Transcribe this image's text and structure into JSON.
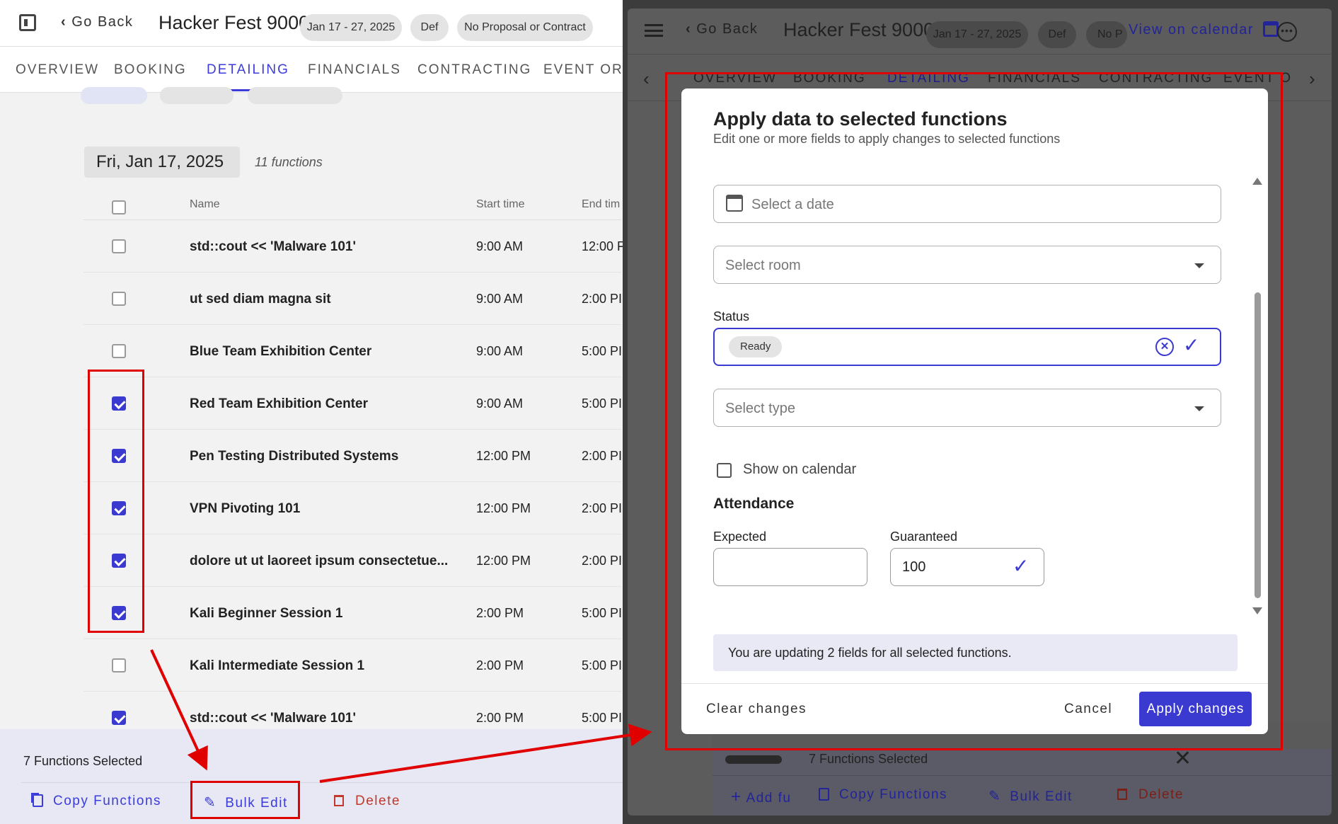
{
  "left": {
    "header": {
      "back": "Go Back",
      "title": "Hacker Fest 9000",
      "dates": "Jan 17 - 27, 2025",
      "status": "Def",
      "contract": "No Proposal or Contract"
    },
    "tabs": [
      "OVERVIEW",
      "BOOKING",
      "DETAILING",
      "FINANCIALS",
      "CONTRACTING",
      "EVENT ORDE"
    ],
    "date_heading": "Fri, Jan 17, 2025",
    "function_count": "11 functions",
    "columns": {
      "name": "Name",
      "start": "Start time",
      "end": "End tim"
    },
    "rows": [
      {
        "name": "std::cout << 'Malware 101'",
        "start": "9:00 AM",
        "end": "12:00 F",
        "checked": false
      },
      {
        "name": "ut sed diam magna sit",
        "start": "9:00 AM",
        "end": "2:00 PI",
        "checked": false
      },
      {
        "name": "Blue Team Exhibition Center",
        "start": "9:00 AM",
        "end": "5:00 PI",
        "checked": false
      },
      {
        "name": "Red Team Exhibition Center",
        "start": "9:00 AM",
        "end": "5:00 PI",
        "checked": true
      },
      {
        "name": "Pen Testing Distributed Systems",
        "start": "12:00 PM",
        "end": "2:00 PI",
        "checked": true
      },
      {
        "name": "VPN Pivoting 101",
        "start": "12:00 PM",
        "end": "2:00 PI",
        "checked": true
      },
      {
        "name": "dolore ut ut laoreet ipsum consectetue...",
        "start": "12:00 PM",
        "end": "2:00 PI",
        "checked": true
      },
      {
        "name": "Kali Beginner Session 1",
        "start": "2:00 PM",
        "end": "5:00 PI",
        "checked": true
      },
      {
        "name": "Kali Intermediate Session 1",
        "start": "2:00 PM",
        "end": "5:00 PI",
        "checked": false
      },
      {
        "name": "std::cout << 'Malware 101'",
        "start": "2:00 PM",
        "end": "5:00 PI",
        "checked": true
      }
    ],
    "footer": {
      "selected": "7 Functions Selected",
      "copy": "Copy Functions",
      "bulk_edit": "Bulk Edit",
      "delete": "Delete"
    }
  },
  "right": {
    "header": {
      "back": "Go Back",
      "title": "Hacker Fest 9000",
      "dates": "Jan 17 - 27, 2025",
      "status": "Def",
      "contract": "No P",
      "view_calendar": "View on calendar"
    },
    "tabs": [
      "OVERVIEW",
      "BOOKING",
      "DETAILING",
      "FINANCIALS",
      "CONTRACTING",
      "EVENT O"
    ],
    "footer": {
      "selected": "7 Functions Selected",
      "add": "Add fu",
      "copy": "Copy Functions",
      "bulk_edit": "Bulk Edit",
      "delete": "Delete"
    }
  },
  "modal": {
    "title": "Apply data to selected functions",
    "subtitle": "Edit one or more fields to apply changes to selected functions",
    "date_placeholder": "Select a date",
    "room_placeholder": "Select room",
    "status_label": "Status",
    "status_value": "Ready",
    "type_placeholder": "Select type",
    "show_on_calendar": "Show on calendar",
    "attendance_heading": "Attendance",
    "expected_label": "Expected",
    "expected_value": "",
    "guaranteed_label": "Guaranteed",
    "guaranteed_value": "100",
    "notice": "You are updating 2 fields for all selected functions.",
    "clear": "Clear changes",
    "cancel": "Cancel",
    "apply": "Apply changes"
  },
  "colors": {
    "accent": "#3a3ad0",
    "annotation": "#e00000",
    "overlay": "#5a5a5a"
  }
}
